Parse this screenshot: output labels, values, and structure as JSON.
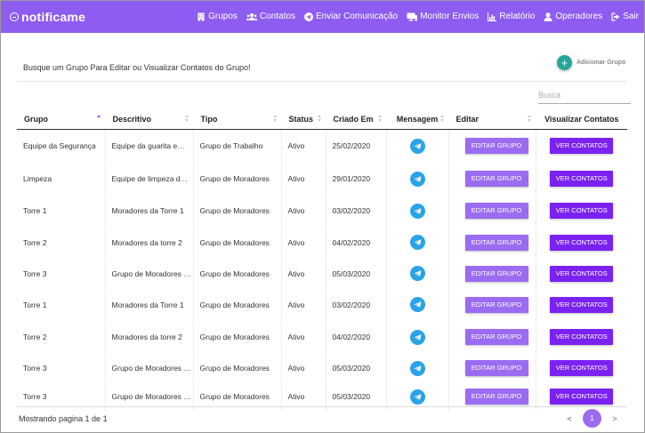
{
  "app": {
    "name": "notificame"
  },
  "nav": [
    {
      "label": "Grupos",
      "icon": "building-icon"
    },
    {
      "label": "Contatos",
      "icon": "users-icon"
    },
    {
      "label": "Enviar Comunicação",
      "icon": "send-icon"
    },
    {
      "label": "Monitor Envios",
      "icon": "monitor-icon"
    },
    {
      "label": "Relatório",
      "icon": "chart-icon"
    },
    {
      "label": "Operadores",
      "icon": "user-icon"
    },
    {
      "label": "Sair",
      "icon": "logout-icon"
    }
  ],
  "page": {
    "intro": "Busque um Grupo Para Editar ou Visualizar Contatos do Grupo!",
    "add_label": "Adicionar Grupo",
    "add_icon": "+",
    "search_placeholder": "Busca"
  },
  "table": {
    "headers": {
      "grupo": "Grupo",
      "descritivo": "Descritivo",
      "tipo": "Tipo",
      "status": "Status",
      "criado": "Criado Em",
      "mensagem": "Mensagem",
      "editar": "Editar",
      "visualizar": "Visualizar Contatos"
    },
    "edit_label": "EDITAR GRUPO",
    "view_label": "VER CONTATOS",
    "rows": [
      {
        "grupo": "Equipe da Segurança",
        "descritivo": "Equipe da guarita e…",
        "tipo": "Grupo de Trabalho",
        "status": "Ativo",
        "criado": "25/02/2020"
      },
      {
        "grupo": "Limpeza",
        "descritivo": "Equipe de limpeza d…",
        "tipo": "Grupo de Moradores",
        "status": "Ativo",
        "criado": "29/01/2020"
      },
      {
        "grupo": "Torre 1",
        "descritivo": "Moradores da Torre 1",
        "tipo": "Grupo de Moradores",
        "status": "Ativo",
        "criado": "03/02/2020"
      },
      {
        "grupo": "Torre 2",
        "descritivo": "Moradores da torre 2",
        "tipo": "Grupo de Moradores",
        "status": "Ativo",
        "criado": "04/02/2020"
      },
      {
        "grupo": "Torre 3",
        "descritivo": "Grupo de Moradores …",
        "tipo": "Grupo de Moradores",
        "status": "Ativo",
        "criado": "05/03/2020"
      },
      {
        "grupo": "Torre 1",
        "descritivo": "Moradores da Torre 1",
        "tipo": "Grupo de Moradores",
        "status": "Ativo",
        "criado": "03/02/2020"
      },
      {
        "grupo": "Torre 2",
        "descritivo": "Moradores da torre 2",
        "tipo": "Grupo de Moradores",
        "status": "Ativo",
        "criado": "04/02/2020"
      },
      {
        "grupo": "Torre 3",
        "descritivo": "Grupo de Moradores …",
        "tipo": "Grupo de Moradores",
        "status": "Ativo",
        "criado": "05/03/2020"
      },
      {
        "grupo": "Torre 3",
        "descritivo": "Grupo de Moradores …",
        "tipo": "Grupo de Moradores",
        "status": "Ativo",
        "criado": "05/03/2020"
      }
    ]
  },
  "footer": {
    "status": "Mostrando pagina 1 de 1",
    "prev": "<",
    "page": "1",
    "next": ">"
  },
  "colors": {
    "topbar": "#8e5cf0",
    "edit_button": "#9b6cf2",
    "view_button": "#7b22f2",
    "add_button": "#26a69a",
    "telegram": "#2aa3e8"
  }
}
